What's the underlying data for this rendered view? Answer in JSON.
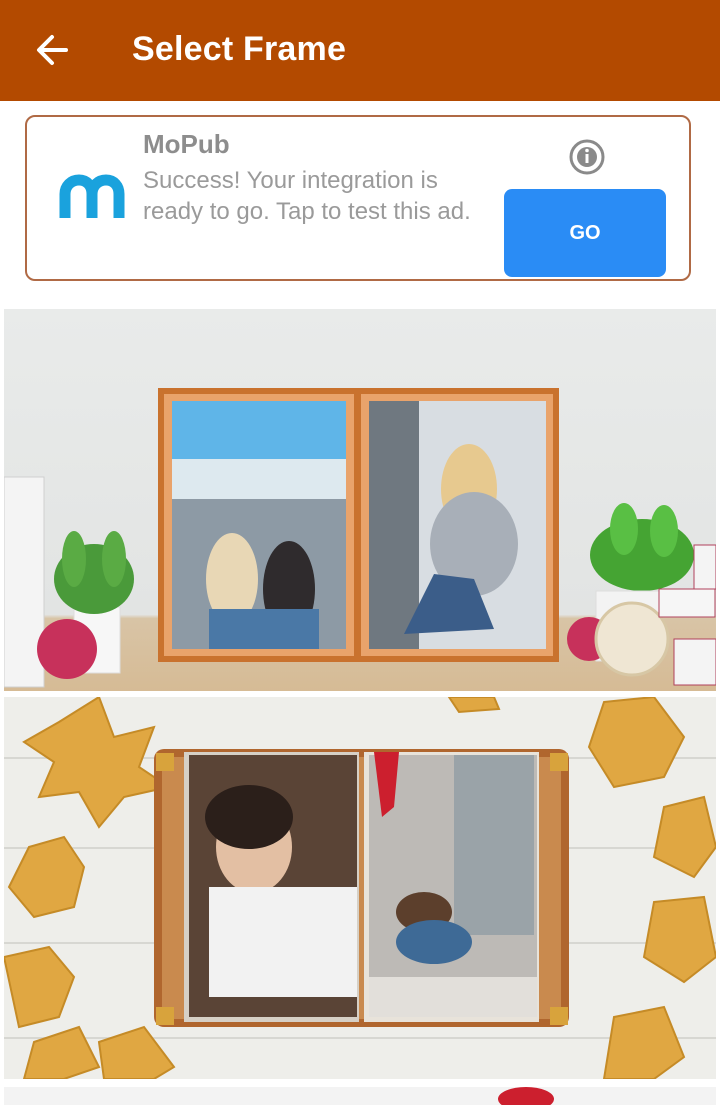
{
  "app_bar": {
    "title": "Select Frame",
    "back_icon": "arrow-left-icon",
    "color": "#b34a00"
  },
  "ad": {
    "brand": "MoPub",
    "text": "Success! Your integration is ready to go. Tap to test this ad.",
    "cta": "GO",
    "info_icon": "info-icon",
    "cta_color": "#2a8cf5"
  },
  "frames": [
    {
      "theme": "double wooden frame on shelf"
    },
    {
      "theme": "open photo book with autumn leaves"
    },
    {
      "theme": "partially visible frame"
    }
  ]
}
